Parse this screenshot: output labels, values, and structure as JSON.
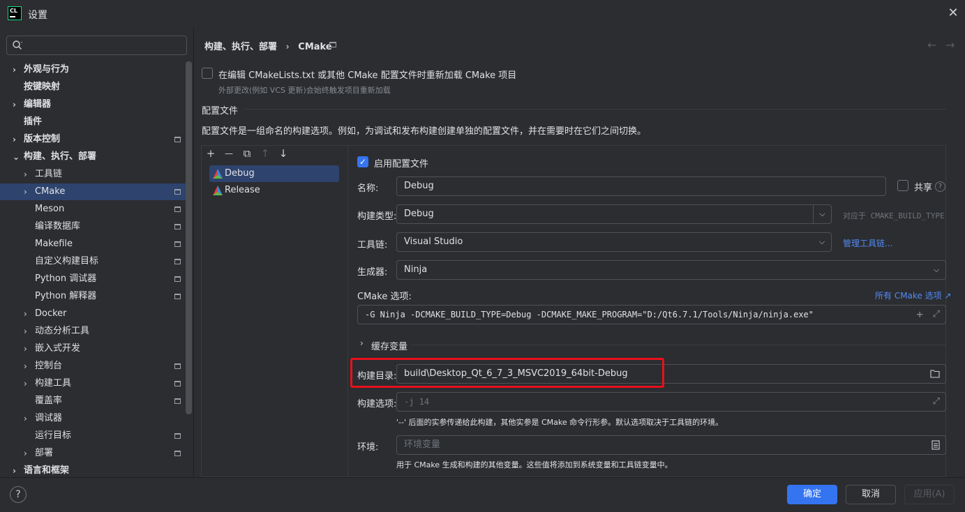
{
  "window": {
    "title": "设置",
    "logo": "CL"
  },
  "search": {
    "placeholder": ""
  },
  "sidebar": {
    "items": [
      {
        "label": "外观与行为",
        "bold": true,
        "expandable": true,
        "level": 0
      },
      {
        "label": "按键映射",
        "bold": true,
        "expandable": false,
        "level": 0
      },
      {
        "label": "编辑器",
        "bold": true,
        "expandable": true,
        "level": 0
      },
      {
        "label": "插件",
        "bold": true,
        "expandable": false,
        "level": 0
      },
      {
        "label": "版本控制",
        "bold": true,
        "expandable": true,
        "level": 0,
        "page": true
      },
      {
        "label": "构建、执行、部署",
        "bold": true,
        "expandable": true,
        "expanded": true,
        "level": 0
      },
      {
        "label": "工具链",
        "expandable": true,
        "level": 1
      },
      {
        "label": "CMake",
        "expandable": true,
        "level": 1,
        "page": true,
        "selected": true
      },
      {
        "label": "Meson",
        "level": 1,
        "page": true
      },
      {
        "label": "编译数据库",
        "level": 1,
        "page": true
      },
      {
        "label": "Makefile",
        "level": 1,
        "page": true
      },
      {
        "label": "自定义构建目标",
        "level": 1,
        "page": true
      },
      {
        "label": "Python 调试器",
        "level": 1,
        "page": true
      },
      {
        "label": "Python 解释器",
        "level": 1,
        "page": true
      },
      {
        "label": "Docker",
        "expandable": true,
        "level": 1
      },
      {
        "label": "动态分析工具",
        "expandable": true,
        "level": 1
      },
      {
        "label": "嵌入式开发",
        "expandable": true,
        "level": 1
      },
      {
        "label": "控制台",
        "expandable": true,
        "level": 1,
        "page": true
      },
      {
        "label": "构建工具",
        "expandable": true,
        "level": 1,
        "page": true
      },
      {
        "label": "覆盖率",
        "level": 1,
        "page": true
      },
      {
        "label": "调试器",
        "expandable": true,
        "level": 1
      },
      {
        "label": "运行目标",
        "level": 1,
        "page": true
      },
      {
        "label": "部署",
        "expandable": true,
        "level": 1,
        "page": true
      },
      {
        "label": "语言和框架",
        "bold": true,
        "expandable": true,
        "level": 0
      }
    ]
  },
  "breadcrumb": {
    "parent": "构建、执行、部署",
    "separator": "›",
    "current": "CMake"
  },
  "reload": {
    "label": "在编辑 CMakeLists.txt 或其他 CMake 配置文件时重新加载 CMake 项目",
    "hint": "外部更改(例如 VCS 更新)会始终触发项目重新加载",
    "checked": false
  },
  "profiles_section": {
    "title": "配置文件",
    "description": "配置文件是一组命名的构建选项。例如，为调试和发布构建创建单独的配置文件，并在需要时在它们之间切换。"
  },
  "toolbar": {
    "add": "+",
    "remove": "—",
    "copy": "⧉",
    "up": "↑",
    "down": "↓"
  },
  "profiles": [
    {
      "name": "Debug",
      "selected": true
    },
    {
      "name": "Release",
      "selected": false
    }
  ],
  "form": {
    "enable_label": "启用配置文件",
    "enable_checked": true,
    "name_label": "名称:",
    "name_value": "Debug",
    "share_label": "共享",
    "build_type_label": "构建类型:",
    "build_type_value": "Debug",
    "build_type_hint": "对应于 CMAKE_BUILD_TYPE",
    "toolchain_label": "工具链:",
    "toolchain_value": "Visual Studio",
    "manage_toolchains": "管理工具链...",
    "generator_label": "生成器:",
    "generator_value": "Ninja",
    "cmake_options_label": "CMake 选项:",
    "all_cmake_options": "所有 CMake 选项 ↗",
    "cmake_options_value": "-G Ninja -DCMAKE_BUILD_TYPE=Debug -DCMAKE_MAKE_PROGRAM=\"D:/Qt6.7.1/Tools/Ninja/ninja.exe\"",
    "cache_vars_label": "缓存变量",
    "build_dir_label": "构建目录:",
    "build_dir_value": "build\\Desktop_Qt_6_7_3_MSVC2019_64bit-Debug",
    "build_options_label": "构建选项:",
    "build_options_placeholder": "-j 14",
    "build_options_hint": "'--' 后面的实参传递给此构建，其他实参是 CMake 命令行形参。默认选项取决于工具链的环境。",
    "env_label": "环境:",
    "env_placeholder": "环境变量",
    "env_hint": "用于 CMake 生成和构建的其他变量。这些值将添加到系统变量和工具链变量中。"
  },
  "buttons": {
    "ok": "确定",
    "cancel": "取消",
    "apply": "应用(A)",
    "help": "?"
  },
  "colors": {
    "accent": "#3574f0",
    "highlight": "#e8101c",
    "selection": "#2e436e"
  }
}
